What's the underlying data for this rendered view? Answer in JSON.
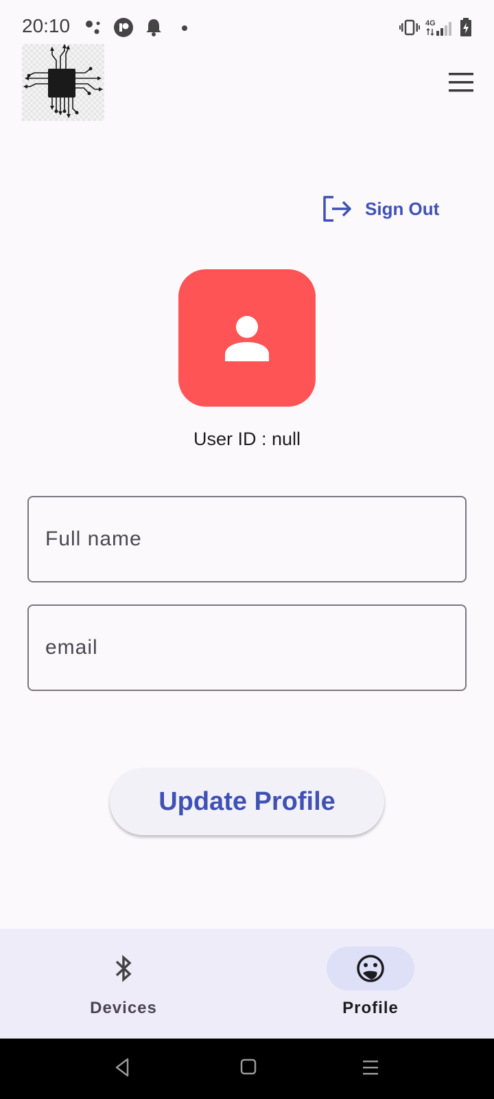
{
  "status_bar": {
    "time": "20:10",
    "network_label": "4G",
    "left_icons": [
      "assistant-dots-icon",
      "app-badge-icon",
      "bell-icon",
      "dot-icon"
    ],
    "right_icons": [
      "vibrate-icon",
      "signal-icon",
      "battery-charging-icon"
    ]
  },
  "header": {
    "logo_icon": "circuit-chip-logo",
    "menu_icon": "hamburger-menu-icon"
  },
  "account": {
    "signout_icon": "logout-icon",
    "signout_label": "Sign Out"
  },
  "profile": {
    "avatar_icon": "person-icon",
    "avatar_color": "#ff5456",
    "user_id_text": "User ID : null"
  },
  "form": {
    "full_name_placeholder": "Full name",
    "email_placeholder": "email",
    "update_button_label": "Update Profile"
  },
  "bottom_nav": {
    "items": [
      {
        "label": "Devices",
        "icon": "bluetooth-icon",
        "selected": false
      },
      {
        "label": "Profile",
        "icon": "face-icon",
        "selected": true
      }
    ]
  },
  "system_nav": {
    "icons": [
      "back-icon",
      "home-icon",
      "recents-icon"
    ]
  },
  "colors": {
    "accent": "#3f51b5",
    "background": "#fcf9fc",
    "nav_background": "#eeecf9",
    "nav_selected_pill": "#dde0f6"
  }
}
